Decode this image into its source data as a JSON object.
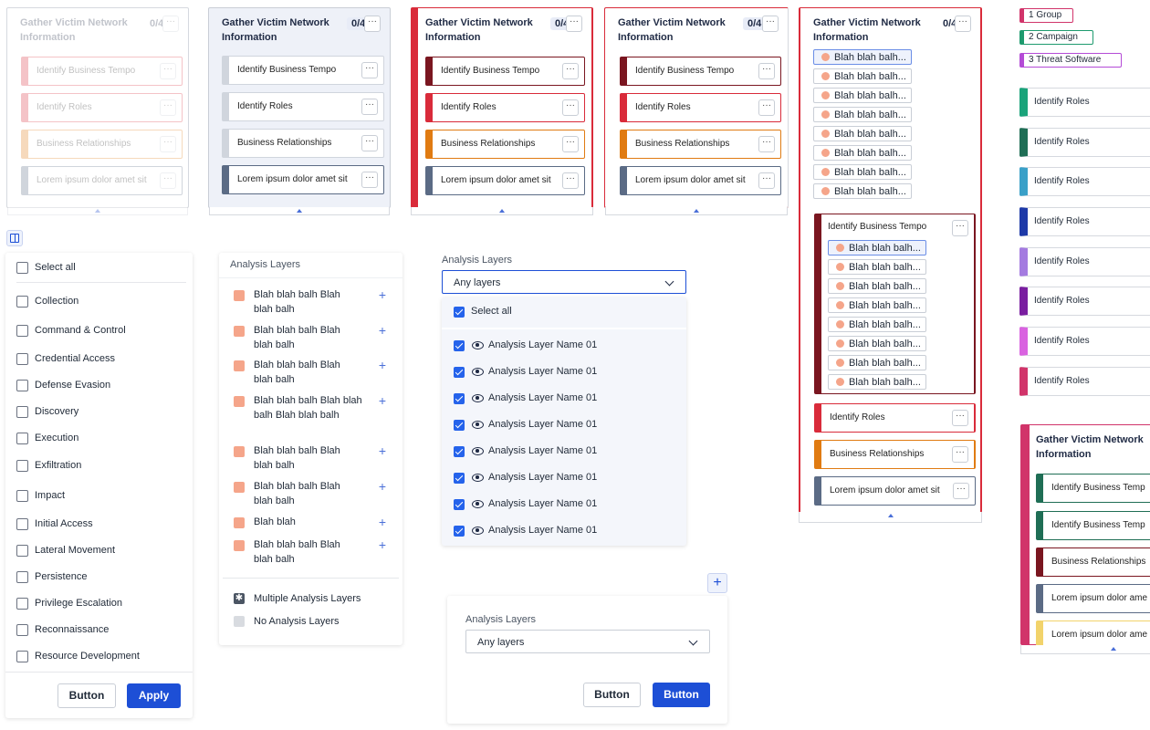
{
  "card_title": "Gather Victim Network Information",
  "card_count": "0/4",
  "more_glyph": "···",
  "techniques": {
    "business_tempo": "Identify Business Tempo",
    "roles": "Identify Roles",
    "business_relationships": "Business Relationships",
    "lorem": "Lorem ipsum dolor amet sit",
    "lorem_short": "Lorem ipsum dolor ame",
    "business_tempo_short": "Identify Business Temp"
  },
  "blah_item": "Blah blah balh...",
  "filter": {
    "select_all": "Select all",
    "items": [
      "Collection",
      "Command & Control",
      "Credential Access",
      "Defense Evasion",
      "Discovery",
      "Execution",
      "Exfiltration",
      "Impact",
      "Initial Access",
      "Lateral Movement",
      "Persistence",
      "Privilege Escalation",
      "Reconnaissance",
      "Resource Development"
    ],
    "button": "Button",
    "apply": "Apply"
  },
  "legend": {
    "title": "Analysis Layers",
    "items": [
      "Blah blah balh Blah blah balh",
      "Blah blah balh Blah blah balh",
      "Blah blah balh Blah blah balh",
      "Blah blah balh Blah blah balh Blah blah balh",
      "Blah blah balh Blah blah balh",
      "Blah blah balh Blah blah balh",
      "Blah blah",
      "Blah blah balh Blah blah balh"
    ],
    "multiple": "Multiple Analysis Layers",
    "none": "No Analysis Layers"
  },
  "dropdown": {
    "label": "Analysis Layers",
    "value": "Any layers",
    "select_all": "Select all",
    "options": [
      "Analysis Layer Name 01",
      "Analysis Layer Name 01",
      "Analysis Layer Name 01",
      "Analysis Layer Name 01",
      "Analysis Layer Name 01",
      "Analysis Layer Name 01",
      "Analysis Layer Name 01",
      "Analysis Layer Name 01"
    ]
  },
  "modal": {
    "label": "Analysis Layers",
    "value": "Any layers",
    "button_secondary": "Button",
    "button_primary": "Button"
  },
  "tags": [
    "1 Group",
    "2 Campaign",
    "3 Threat Software"
  ],
  "colors": {
    "accent": "#1d4fd6",
    "red": "#d92b3a",
    "dark_red": "#7a1620",
    "orange": "#e07b12",
    "slate": "#5b6b85",
    "layer_orange": "#f5a58a"
  }
}
